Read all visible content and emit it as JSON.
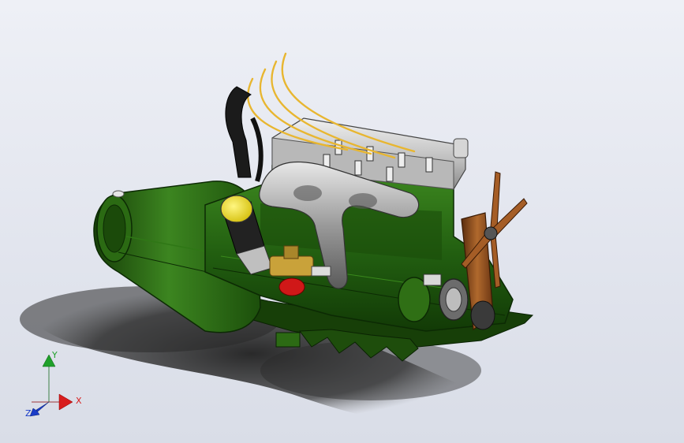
{
  "viewport": {
    "model": "engine-assembly",
    "colors": {
      "background": "#e6e9f1",
      "block_green": "#1f5a0e",
      "block_green_light": "#3d8a1f",
      "cylinder_head": "#c9c9c9",
      "fuel_lines": "#e8b630",
      "air_filter_top": "#f2e32a",
      "fan_wood": "#8b4a1f",
      "carb_brass": "#c9a23a",
      "red_bowl": "#d01818",
      "shadow": "#3a3a3a"
    }
  },
  "triad": {
    "x_label": "X",
    "y_label": "Y",
    "z_label": "Z",
    "x_color": "#d81e1e",
    "y_color": "#1fa02a",
    "z_color": "#1a3cc8"
  }
}
